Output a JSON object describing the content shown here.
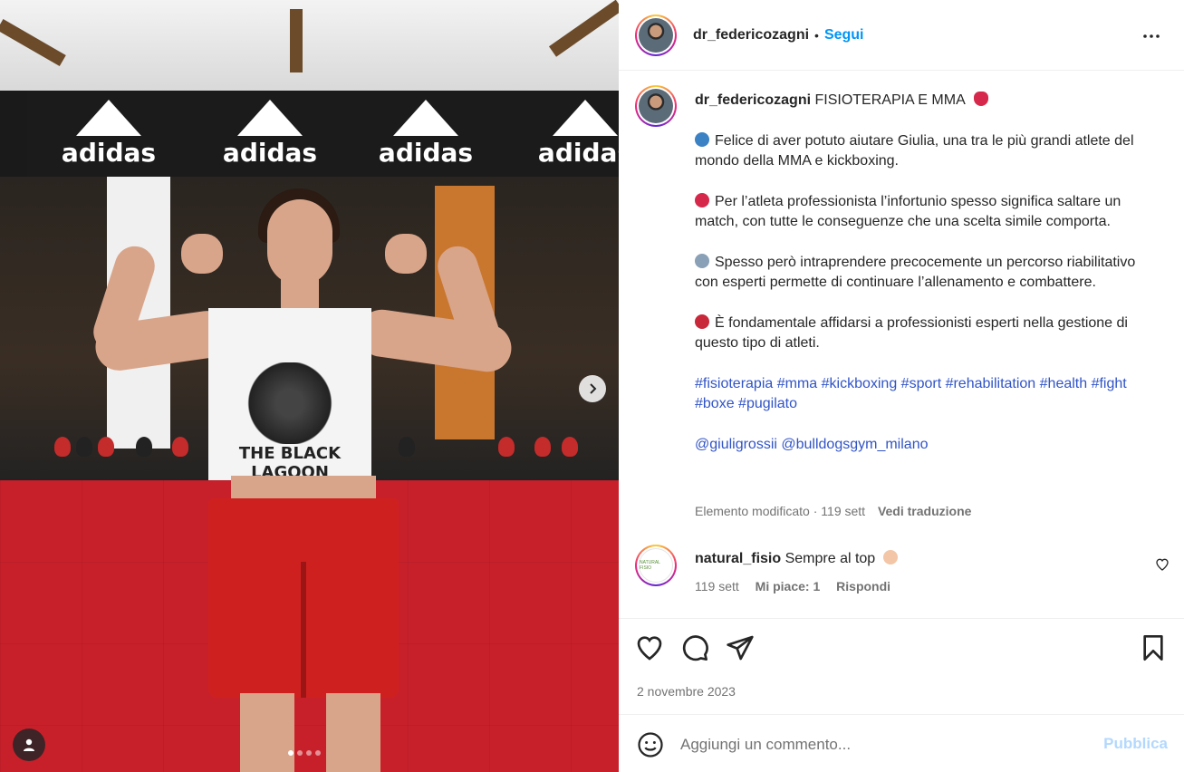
{
  "post": {
    "username": "dr_federicozagni",
    "separator": "•",
    "follow_label": "Segui",
    "more_icon": "more-options-icon",
    "caption": {
      "username": "dr_federicozagni",
      "title": "FISIOTERAPIA E MMA",
      "title_emoji": "boxing-glove-icon",
      "paragraphs": [
        {
          "emoji": "globe-icon",
          "emoji_color": "#3b82c4",
          "text": "Felice di aver potuto aiutare Giulia, una tra le più grandi atlete del mondo della MMA e kickboxing."
        },
        {
          "emoji": "drop-icon",
          "emoji_color": "#d6284b",
          "text": "Per l’atleta professionista l’infortunio spesso significa saltare un match, con tutte le conseguenze che una scelta simile comporta."
        },
        {
          "emoji": "airplane-icon",
          "emoji_color": "#8aa0b6",
          "text": "Spesso però intraprendere precocemente un percorso riabilitativo con esperti permette di continuare l’allenamento e combattere."
        },
        {
          "emoji": "target-icon",
          "emoji_color": "#c8283a",
          "text": "È fondamentale affidarsi a professionisti esperti nella gestione di questo tipo di atleti."
        }
      ],
      "hashtags": "#fisioterapia #mma #kickboxing #sport #rehabilitation #health #fight #boxe #pugilato",
      "mentions": "@giuligrossii @bulldogsgym_milano",
      "edited_label": "Elemento modificato · 119 sett",
      "translate_label": "Vedi traduzione"
    },
    "comment": {
      "username": "natural_fisio",
      "text": "Sempre al top",
      "emoji": "flexed-biceps-icon",
      "time": "119 sett",
      "likes": "Mi piace: 1",
      "reply": "Rispondi",
      "avatar_text": "NATURAL FISIO"
    },
    "date": "2 novembre 2023",
    "add_comment": {
      "placeholder": "Aggiungi un commento...",
      "publish": "Pubblica"
    }
  },
  "media": {
    "brand_text": "adidas",
    "shirt_text": "THE BLACK LAGOON",
    "carousel": {
      "count": 4,
      "active": 0
    }
  },
  "colors": {
    "accent": "#0095f6",
    "hashtag": "#3154c6",
    "muted": "#737373",
    "publish_disabled": "#b3d8fd"
  }
}
